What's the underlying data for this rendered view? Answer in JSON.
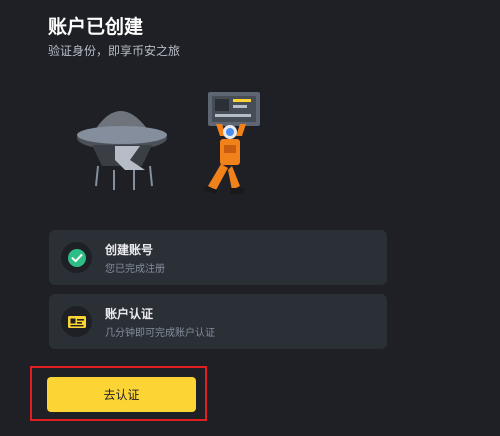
{
  "header": {
    "title": "账户已创建",
    "subtitle": "验证身份，即享币安之旅"
  },
  "steps": [
    {
      "label": "创建账号",
      "description": "您已完成注册",
      "status": "completed",
      "icon": "check-circle-icon"
    },
    {
      "label": "账户认证",
      "description": "几分钟即可完成账户认证",
      "status": "pending",
      "icon": "id-card-icon"
    }
  ],
  "cta": {
    "label": "去认证"
  },
  "colors": {
    "background": "#1e2026",
    "card": "#2b2f36",
    "accent": "#fcd535",
    "success": "#2ebd85",
    "highlight": "#e02020"
  }
}
